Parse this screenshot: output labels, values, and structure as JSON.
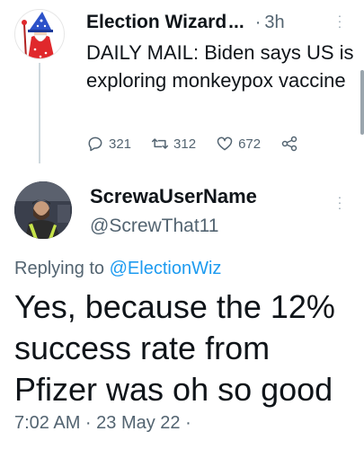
{
  "parent_tweet": {
    "display_name": "Election Wizard",
    "name_ellipsis": "...",
    "separator": "·",
    "time": "3h",
    "text": "DAILY MAIL: Biden says US is exploring monkeypox vaccine",
    "counts": {
      "replies": "321",
      "retweets": "312",
      "likes": "672"
    }
  },
  "reply": {
    "display_name": "ScrewaUserName",
    "handle": "@ScrewThat11",
    "replying_prefix": "Replying to",
    "replying_to": "@ElectionWiz",
    "text": "Yes, because the 12% success rate from Pfizer was oh so good",
    "meta": "7:02 AM · 23 May 22 ·"
  },
  "colors": {
    "text": "#0f1419",
    "muted": "#536471",
    "link": "#1d9bf0",
    "thread_line": "#cfd9de",
    "wizard_hat": "#2c52c9",
    "wizard_robe": "#e0282c"
  },
  "icons": [
    "reply-icon",
    "retweet-icon",
    "like-icon",
    "share-icon",
    "more-icon"
  ]
}
